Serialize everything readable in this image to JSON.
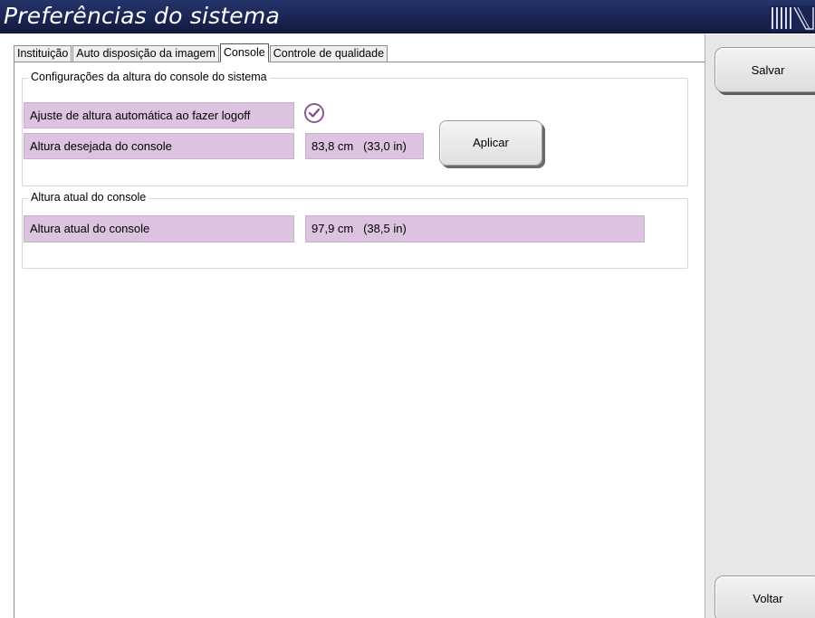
{
  "window": {
    "title": "Preferências do sistema"
  },
  "tabs": [
    {
      "label": "Instituição",
      "active": false
    },
    {
      "label": "Auto disposição da imagem",
      "active": false
    },
    {
      "label": "Console",
      "active": true
    },
    {
      "label": "Controle de qualidade",
      "active": false
    }
  ],
  "height_settings": {
    "group_title": "Configurações da altura do console do sistema",
    "auto_adjust_label": "Ajuste de altura automática ao fazer logoff",
    "auto_adjust_checked": true,
    "desired_height_label": "Altura desejada do console",
    "desired_height_value": "83,8 cm   (33,0 in)",
    "apply_button": "Aplicar"
  },
  "current_height": {
    "group_title": "Altura atual do console",
    "label": "Altura atual do console",
    "value": "97,9 cm   (38,5 in)"
  },
  "sidebar": {
    "save_button": "Salvar",
    "back_button": "Voltar"
  },
  "colors": {
    "titlebar": "#1a2554",
    "field_background": "#dcc3df",
    "check_accent": "#8a5a94",
    "sidebar_background": "#e7e7e7"
  }
}
